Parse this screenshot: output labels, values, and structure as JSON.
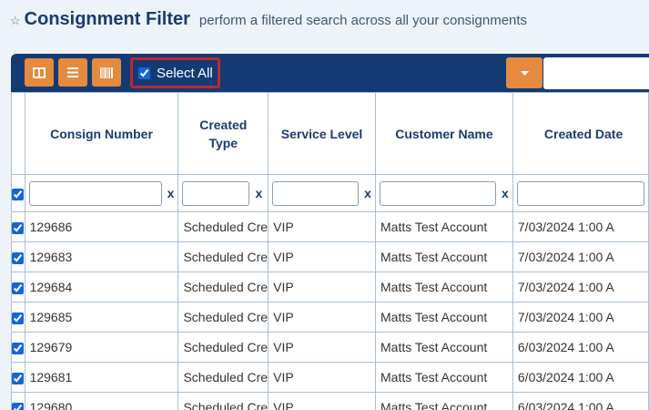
{
  "header": {
    "title": "Consignment Filter",
    "subtitle": "perform a filtered search across all your consignments"
  },
  "toolbar": {
    "select_all_label": "Select All",
    "select_all_checked": true,
    "buttons": [
      "columns-icon",
      "list-icon",
      "barcode-icon",
      "caret-down-icon"
    ]
  },
  "grid": {
    "columns": [
      "Consign Number",
      "Created Type",
      "Service Level",
      "Customer Name",
      "Created Date"
    ],
    "clear_label": "x",
    "rows": [
      [
        "129686",
        "Scheduled Cre",
        "VIP",
        "Matts Test Account",
        "7/03/2024 1:00 A"
      ],
      [
        "129683",
        "Scheduled Cre",
        "VIP",
        "Matts Test Account",
        "7/03/2024 1:00 A"
      ],
      [
        "129684",
        "Scheduled Cre",
        "VIP",
        "Matts Test Account",
        "7/03/2024 1:00 A"
      ],
      [
        "129685",
        "Scheduled Cre",
        "VIP",
        "Matts Test Account",
        "7/03/2024 1:00 A"
      ],
      [
        "129679",
        "Scheduled Cre",
        "VIP",
        "Matts Test Account",
        "6/03/2024 1:00 A"
      ],
      [
        "129681",
        "Scheduled Cre",
        "VIP",
        "Matts Test Account",
        "6/03/2024 1:00 A"
      ],
      [
        "129680",
        "Scheduled Cre",
        "VIP",
        "Matts Test Account",
        "6/03/2024 1:00 A"
      ]
    ]
  },
  "colors": {
    "navy": "#143a73",
    "orange": "#e58a3f",
    "highlight": "#c0272d",
    "background": "#eef3fa"
  }
}
